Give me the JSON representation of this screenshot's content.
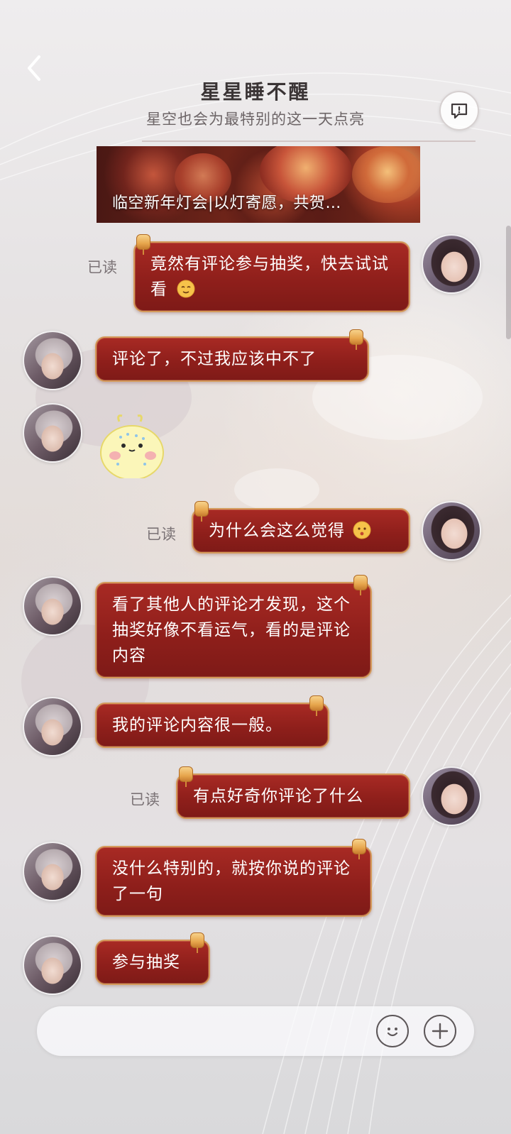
{
  "header": {
    "title": "星星睡不醒",
    "subtitle": "星空也会为最特别的这一天点亮"
  },
  "banner": {
    "text": "临空新年灯会|以灯寄愿，共贺…"
  },
  "messages": [
    {
      "sender": "self",
      "text": "竟然有评论参与抽奖，快去试试看",
      "emoji": "smile-emoji",
      "read": "已读"
    },
    {
      "sender": "other",
      "text": "评论了，不过我应该中不了"
    },
    {
      "sender": "other",
      "sticker": "crying-chick-sticker"
    },
    {
      "sender": "self",
      "text": "为什么会这么觉得",
      "emoji": "surprised-emoji",
      "read": "已读"
    },
    {
      "sender": "other",
      "text": "看了其他人的评论才发现，这个抽奖好像不看运气，看的是评论内容"
    },
    {
      "sender": "other",
      "text": "我的评论内容很一般。"
    },
    {
      "sender": "self",
      "text": "有点好奇你评论了什么",
      "read": "已读"
    },
    {
      "sender": "other",
      "text": "没什么特别的，就按你说的评论了一句"
    },
    {
      "sender": "other",
      "text": "参与抽奖"
    }
  ],
  "input": {
    "placeholder": ""
  },
  "icons": {
    "back": "chevron-left-icon",
    "feedback": "chat-feedback-icon",
    "emoji": "emoji-icon",
    "plus": "plus-icon"
  },
  "colors": {
    "bubble": "#951f1c",
    "bubble_border": "#d49a5a",
    "text_on_bubble": "#ffffff"
  }
}
